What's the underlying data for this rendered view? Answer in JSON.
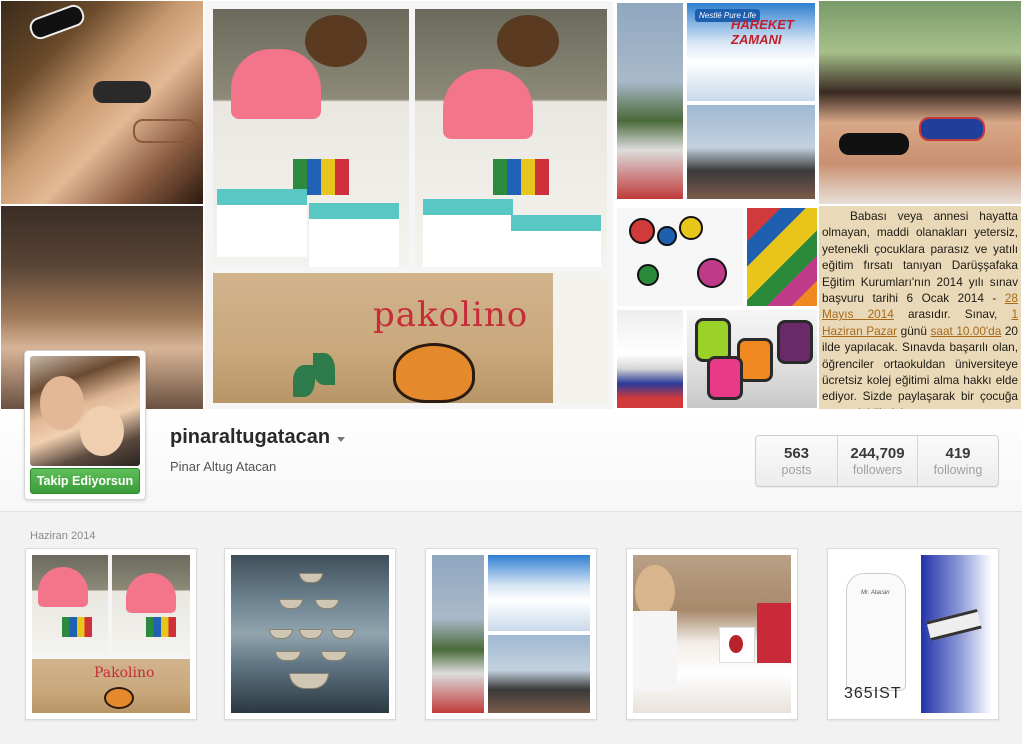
{
  "collage": {
    "box_brand": "pakolino",
    "event_sign_brand": "Nestlé Pure Life",
    "event_sign_title": "HAREKET ZAMANI",
    "notice": {
      "p1": "Babası veya annesi hayatta olmayan, maddi olanakları yetersiz, yetenekli çocuklara parasız ve yatılı eğitim fırsatı tanıyan Darüşşafaka Eğitim Kurumları'nın 2014 yılı sınav başvuru tarihi 6 Ocak 2014 - ",
      "hl1": "28 Mayıs 2014",
      "p2": " arasıdır. Sınav, ",
      "hl2": "1 Haziran Pazar",
      "p3": " günü ",
      "hl3": "saat 10.00'da",
      "p4": " 20 ilde yapılacak. Sınavda başarılı olan, öğrenciler ortaokuldan üniversiteye ücretsiz kolej eğitimi alma hakkı elde ediyor. Sizde paylaşarak bir çocuğa umut olabilirsiniz",
      "sig": "▲▲▲▲"
    }
  },
  "profile": {
    "username": "pinaraltugatacan",
    "full_name": "Pinar Altug Atacan",
    "follow_button": "Takip Ediyorsun",
    "stats": [
      {
        "value": "563",
        "label": "posts"
      },
      {
        "value": "244,709",
        "label": "followers"
      },
      {
        "value": "419",
        "label": "following"
      }
    ]
  },
  "feed": {
    "section_label": "Haziran 2014",
    "thumb_text": {
      "box_brand": "Pakolino",
      "robe_brand": "365IST",
      "robe_label": "Mr. Atacan"
    }
  },
  "colors": {
    "follow_green": "#3a9b38",
    "notice_highlight": "#a86a1a",
    "box_brand_red": "#c62d3a"
  }
}
